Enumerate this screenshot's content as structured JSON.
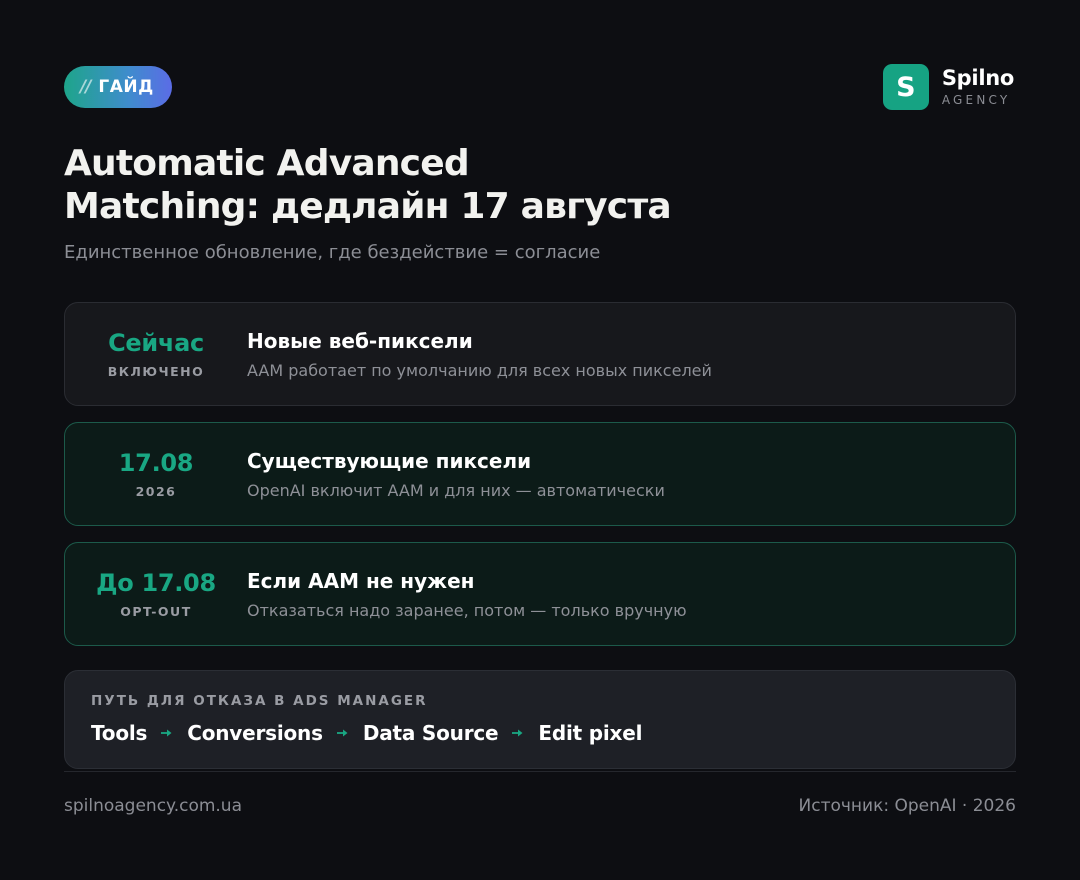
{
  "badge": {
    "slashes": "//",
    "label": "ГАЙД"
  },
  "brand": {
    "mark": "S",
    "name": "Spilno",
    "sub": "AGENCY",
    "color": "#16a383"
  },
  "title_lines": [
    "Automatic Advanced",
    "Matching: дедлайн 17 августа"
  ],
  "subtitle": "Единственное обновление, где бездействие = согласие",
  "timeline": [
    {
      "date": "Сейчас",
      "date_sub": "ВКЛЮЧЕНО",
      "title": "Новые веб-пиксели",
      "desc": "AAM работает по умолчанию для всех новых пикселей",
      "style": "neutral"
    },
    {
      "date": "17.08",
      "date_sub": "2026",
      "title": "Существующие пиксели",
      "desc": "OpenAI включит AAM и для них — автоматически",
      "style": "accent"
    },
    {
      "date": "До 17.08",
      "date_sub": "OPT-OUT",
      "title": "Если AAM не нужен",
      "desc": "Отказаться надо заранее, потом — только вручную",
      "style": "accent"
    }
  ],
  "path": {
    "label": "ПУТЬ ДЛЯ ОТКАЗА В ADS MANAGER",
    "steps": [
      "Tools",
      "Conversions",
      "Data Source",
      "Edit pixel"
    ]
  },
  "footer": {
    "site": "spilnoagency.com.ua",
    "source": "Источник: OpenAI · 2026"
  },
  "colors": {
    "accent": "#19a783",
    "background": "#0d0e12"
  }
}
